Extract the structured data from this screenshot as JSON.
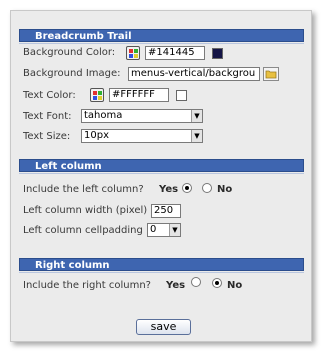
{
  "breadcrumb": {
    "title": "Breadcrumb Trail",
    "bg_color_label": "Background Color:",
    "bg_color_value": "#141445",
    "bg_color_swatch": "#141445",
    "bg_image_label": "Background Image:",
    "bg_image_value": "menus-vertical/backgrou",
    "text_color_label": "Text Color:",
    "text_color_value": "#FFFFFF",
    "text_color_swatch": "#FFFFFF",
    "text_font_label": "Text Font:",
    "text_font_value": "tahoma",
    "text_size_label": "Text Size:",
    "text_size_value": "10px"
  },
  "left_column": {
    "title": "Left column",
    "include_label": "Include the left column?",
    "yes": "Yes",
    "no": "No",
    "selected": "Yes",
    "width_label": "Left column width (pixel)",
    "width_value": "250",
    "cellpadding_label": "Left column cellpadding",
    "cellpadding_value": "0"
  },
  "right_column": {
    "title": "Right column",
    "include_label": "Include the right column?",
    "yes": "Yes",
    "no": "No",
    "selected": "No"
  },
  "save_label": "save",
  "colors": {
    "header_bg": "#3e65b0",
    "panel_bg": "#ebebeb"
  }
}
